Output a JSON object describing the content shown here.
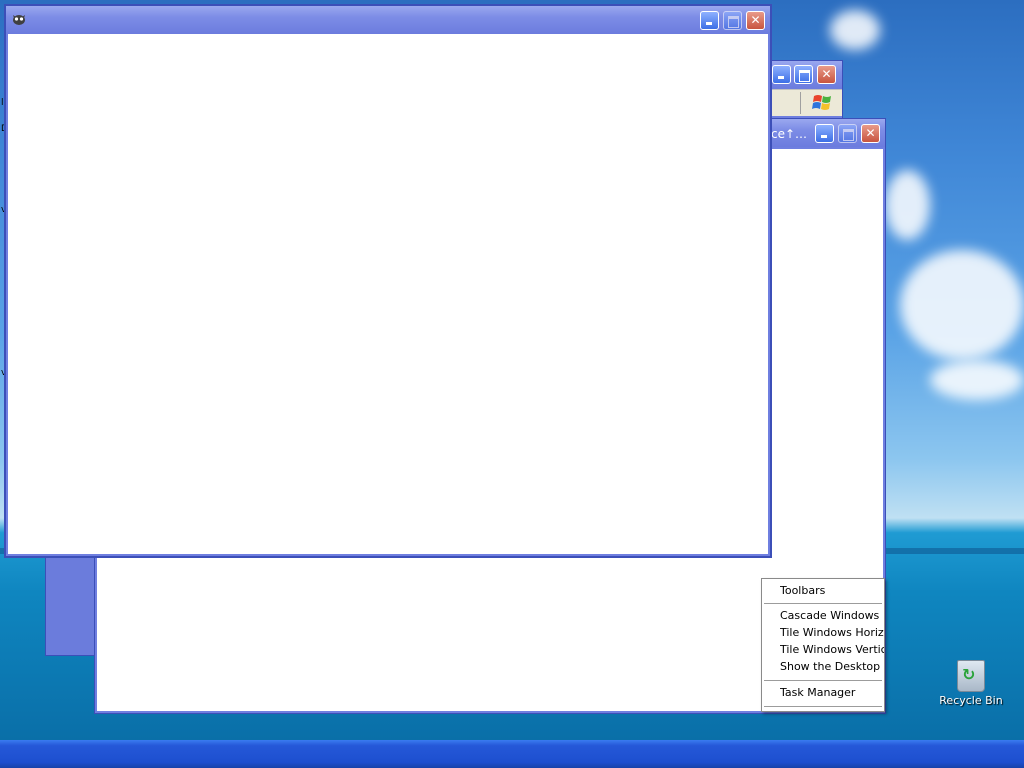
{
  "windows": {
    "front": {
      "title": ""
    },
    "middle": {
      "title": "ce↑…"
    },
    "back": {
      "title": ""
    }
  },
  "context_menu": {
    "items": [
      "Toolbars",
      "Cascade Windows",
      "Tile Windows Horizontally",
      "Tile Windows Vertically",
      "Show the Desktop",
      "Task Manager"
    ]
  },
  "desktop_icons": {
    "recycle_bin": {
      "label": "Recycle Bin",
      "icon": "recycle-bin-icon"
    }
  },
  "left_edge_fragments": [
    "l",
    "D",
    "v",
    "v"
  ],
  "colors": {
    "window_frame": "#6f7fe0",
    "titlebar": "#7c8ce6",
    "taskbar": "#2558d8",
    "close_button": "#c8553f"
  }
}
